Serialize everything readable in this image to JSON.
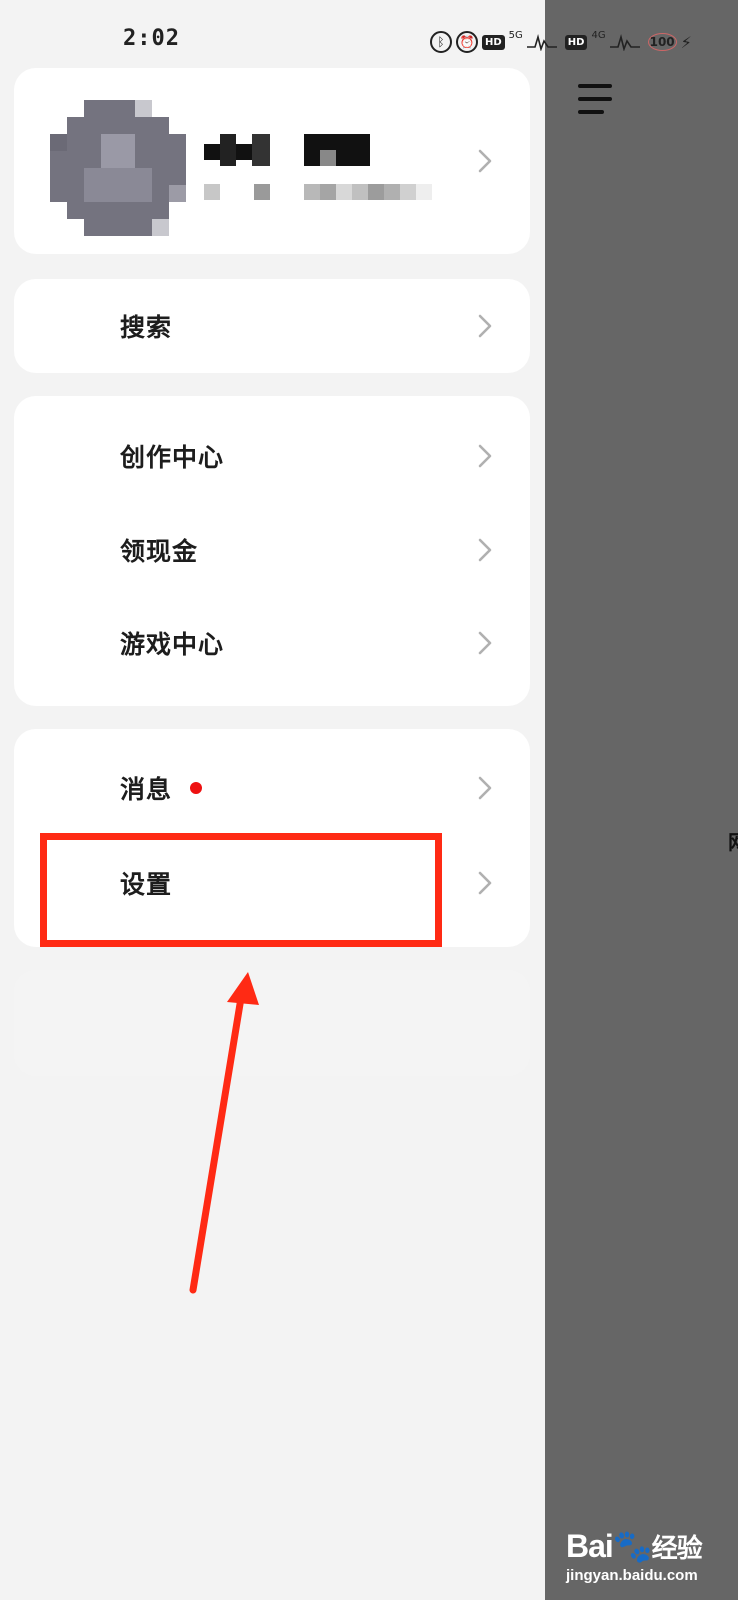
{
  "status_bar": {
    "time": "2:02",
    "net1": "5G",
    "net2": "4G",
    "hd_label": "HD",
    "battery": "100",
    "icons": [
      "bluetooth-icon",
      "alarm-icon",
      "hd-icon",
      "signal-icon",
      "hd-icon",
      "signal-icon",
      "battery-icon",
      "charging-icon"
    ]
  },
  "profile": {
    "avatar": "avatar-blurred",
    "name": "",
    "subtitle": ""
  },
  "menu": {
    "search": "搜索",
    "creator_center": "创作中心",
    "cash": "领现金",
    "game_center": "游戏中心",
    "messages": "消息",
    "settings": "设置"
  },
  "messages_badge_color": "#e11111",
  "annotation": {
    "highlight_color": "#ff2a14",
    "target": "settings"
  },
  "watermark": {
    "brand": "Bai",
    "brand_suffix": "经验",
    "url": "jingyan.baidu.com"
  }
}
